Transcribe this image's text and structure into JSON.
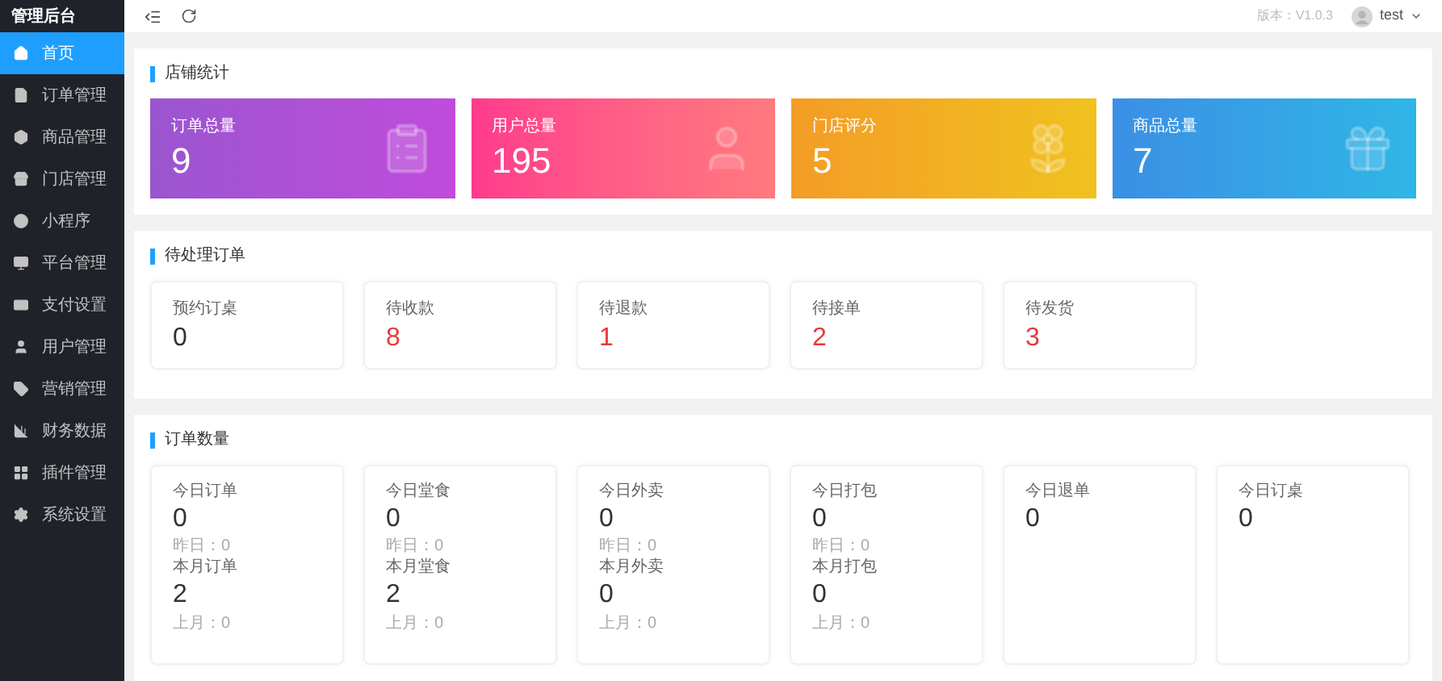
{
  "sidebar": {
    "title": "管理后台",
    "items": [
      {
        "label": "首页",
        "selected": true
      },
      {
        "label": "订单管理",
        "selected": false
      },
      {
        "label": "商品管理",
        "selected": false
      },
      {
        "label": "门店管理",
        "selected": false
      },
      {
        "label": "小程序",
        "selected": false
      },
      {
        "label": "平台管理",
        "selected": false
      },
      {
        "label": "支付设置",
        "selected": false
      },
      {
        "label": "用户管理",
        "selected": false
      },
      {
        "label": "营销管理",
        "selected": false
      },
      {
        "label": "财务数据",
        "selected": false
      },
      {
        "label": "插件管理",
        "selected": false
      },
      {
        "label": "系统设置",
        "selected": false
      }
    ]
  },
  "topbar": {
    "version": "版本：V1.0.3",
    "user": "test"
  },
  "store_stats": {
    "title": "店铺统计",
    "cards": [
      {
        "kind": "orders",
        "label": "订单总量",
        "value": "9"
      },
      {
        "kind": "users",
        "label": "用户总量",
        "value": "195"
      },
      {
        "kind": "rating",
        "label": "门店评分",
        "value": "5"
      },
      {
        "kind": "products",
        "label": "商品总量",
        "value": "7"
      }
    ]
  },
  "pending_orders": {
    "title": "待处理订单",
    "items": [
      {
        "label": "预约订桌",
        "value": "0",
        "alert": false
      },
      {
        "label": "待收款",
        "value": "8",
        "alert": true
      },
      {
        "label": "待退款",
        "value": "1",
        "alert": true
      },
      {
        "label": "待接单",
        "value": "2",
        "alert": true
      },
      {
        "label": "待发货",
        "value": "3",
        "alert": true
      }
    ]
  },
  "order_counts": {
    "title": "订单数量",
    "cards": [
      {
        "today_label": "今日订单",
        "today": "0",
        "yesterday": "昨日：0",
        "month_label": "本月订单",
        "month": "2",
        "last_month": "上月：0"
      },
      {
        "today_label": "今日堂食",
        "today": "0",
        "yesterday": "昨日：0",
        "month_label": "本月堂食",
        "month": "2",
        "last_month": "上月：0"
      },
      {
        "today_label": "今日外卖",
        "today": "0",
        "yesterday": "昨日：0",
        "month_label": "本月外卖",
        "month": "0",
        "last_month": "上月：0"
      },
      {
        "today_label": "今日打包",
        "today": "0",
        "yesterday": "昨日：0",
        "month_label": "本月打包",
        "month": "0",
        "last_month": "上月：0"
      },
      {
        "today_label": "今日退单",
        "today": "0"
      },
      {
        "today_label": "今日订桌",
        "today": "0"
      }
    ]
  }
}
